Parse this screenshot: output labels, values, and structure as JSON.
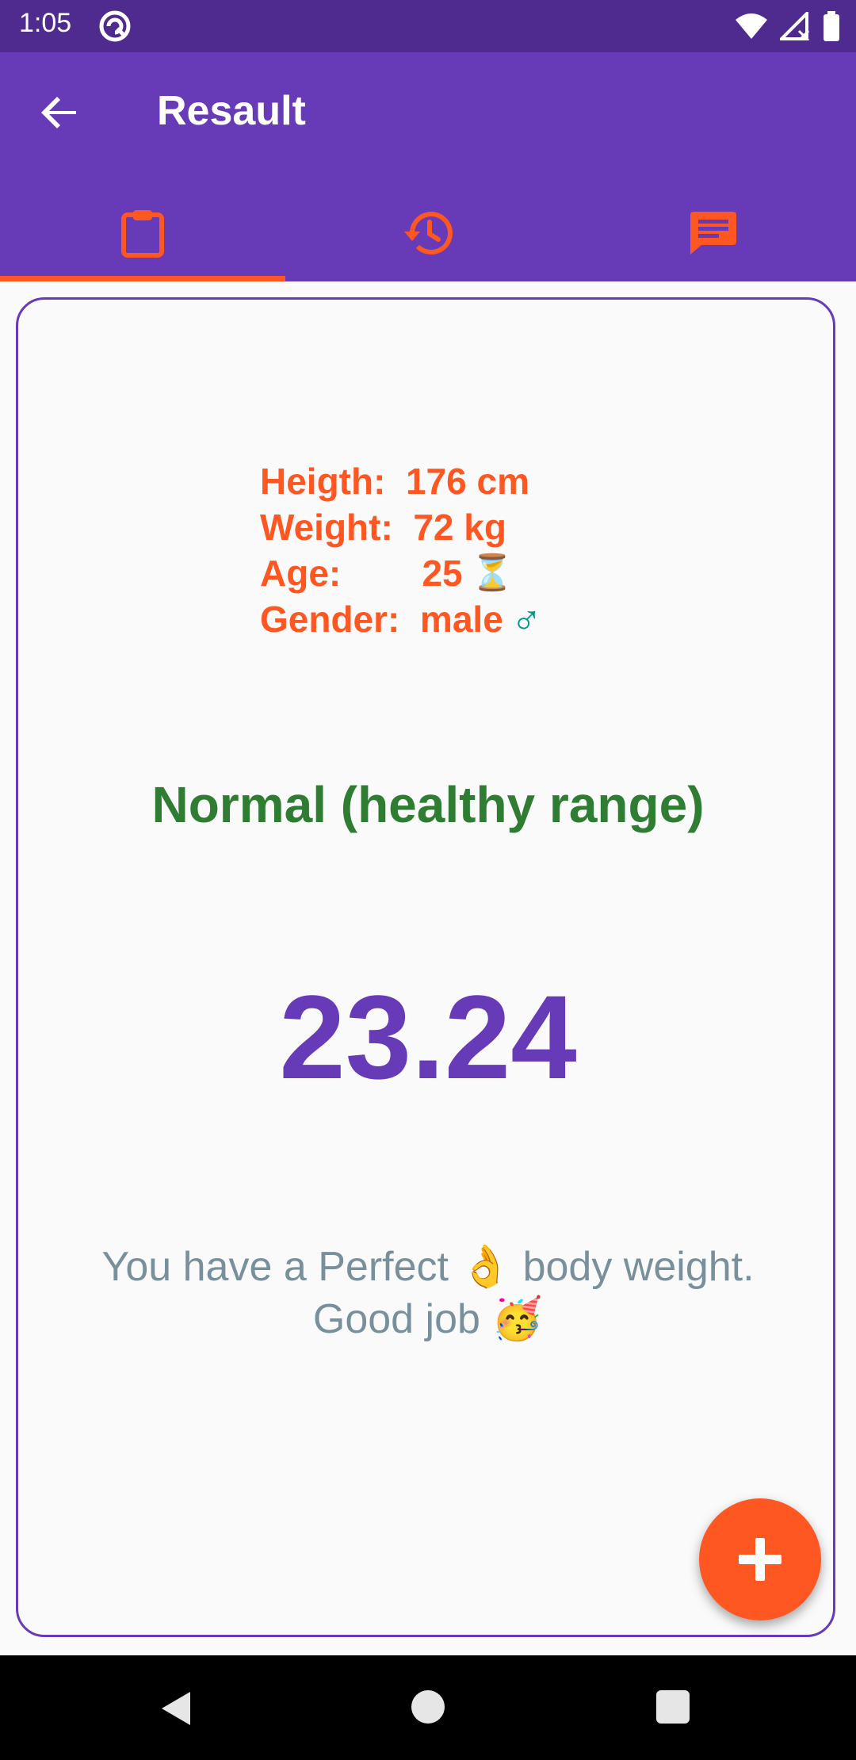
{
  "status_bar": {
    "time": "1:05"
  },
  "app_bar": {
    "title": "Resault"
  },
  "tabs": [
    {
      "name": "clipboard",
      "selected": true
    },
    {
      "name": "history",
      "selected": false
    },
    {
      "name": "message",
      "selected": false
    }
  ],
  "info": {
    "height_line": "Heigth:  176 cm",
    "weight_line": "Weight:  72 kg",
    "age_line": "Age:        25",
    "age_emoji": "⏳",
    "gender_line": "Gender:  male",
    "gender_emoji": "♂"
  },
  "result": {
    "category": "Normal (healthy range)",
    "bmi": "23.24",
    "message_line1_pre": "You have a Perfect ",
    "message_line1_emoji": "👌",
    "message_line1_post": " body weight.",
    "message_line2": "Good job ",
    "message_line2_emoji": "🥳"
  },
  "colors": {
    "primary": "#673ab7",
    "primary_dark": "#4f2b8f",
    "accent": "#ff5722",
    "healthy": "#2e7d32",
    "message": "#78909c"
  }
}
